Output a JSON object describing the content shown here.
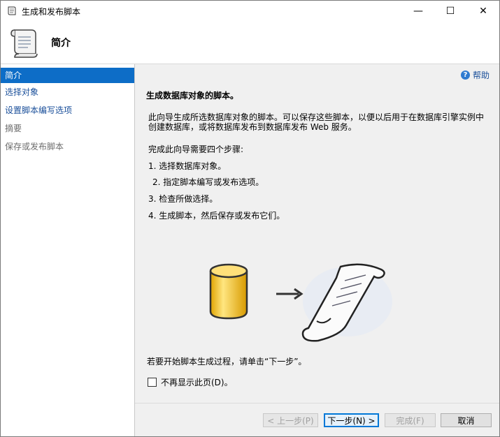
{
  "window": {
    "title": "生成和发布脚本",
    "minimize_symbol": "—",
    "maximize_symbol": "☐",
    "close_symbol": "✕"
  },
  "header": {
    "title": "简介"
  },
  "sidebar": {
    "items": [
      {
        "label": "简介",
        "state": "active"
      },
      {
        "label": "选择对象",
        "state": "link"
      },
      {
        "label": "设置脚本编写选项",
        "state": "link"
      },
      {
        "label": "摘要",
        "state": "disabled"
      },
      {
        "label": "保存或发布脚本",
        "state": "disabled"
      }
    ]
  },
  "main": {
    "help_label": "帮助",
    "heading": "生成数据库对象的脚本。",
    "description": "此向导生成所选数据库对象的脚本。可以保存这些脚本，以便以后用于在数据库引擎实例中创建数据库，或将数据库发布到数据库发布 Web 服务。",
    "steps_intro": "完成此向导需要四个步骤:",
    "steps": [
      "1. 选择数据库对象。",
      "2. 指定脚本编写或发布选项。",
      "3. 检查所做选择。",
      "4. 生成脚本，然后保存或发布它们。"
    ],
    "start_text": "若要开始脚本生成过程，请单击“下一步”。",
    "dont_show_label": "不再显示此页(D)。",
    "dont_show_checked": false
  },
  "buttons": {
    "prev": "< 上一步(P)",
    "next": "下一步(N) >",
    "finish": "完成(F)",
    "cancel": "取消"
  },
  "colors": {
    "accent": "#0d6dc7",
    "link": "#1a4f9a",
    "content_bg": "#f0f0f0"
  }
}
